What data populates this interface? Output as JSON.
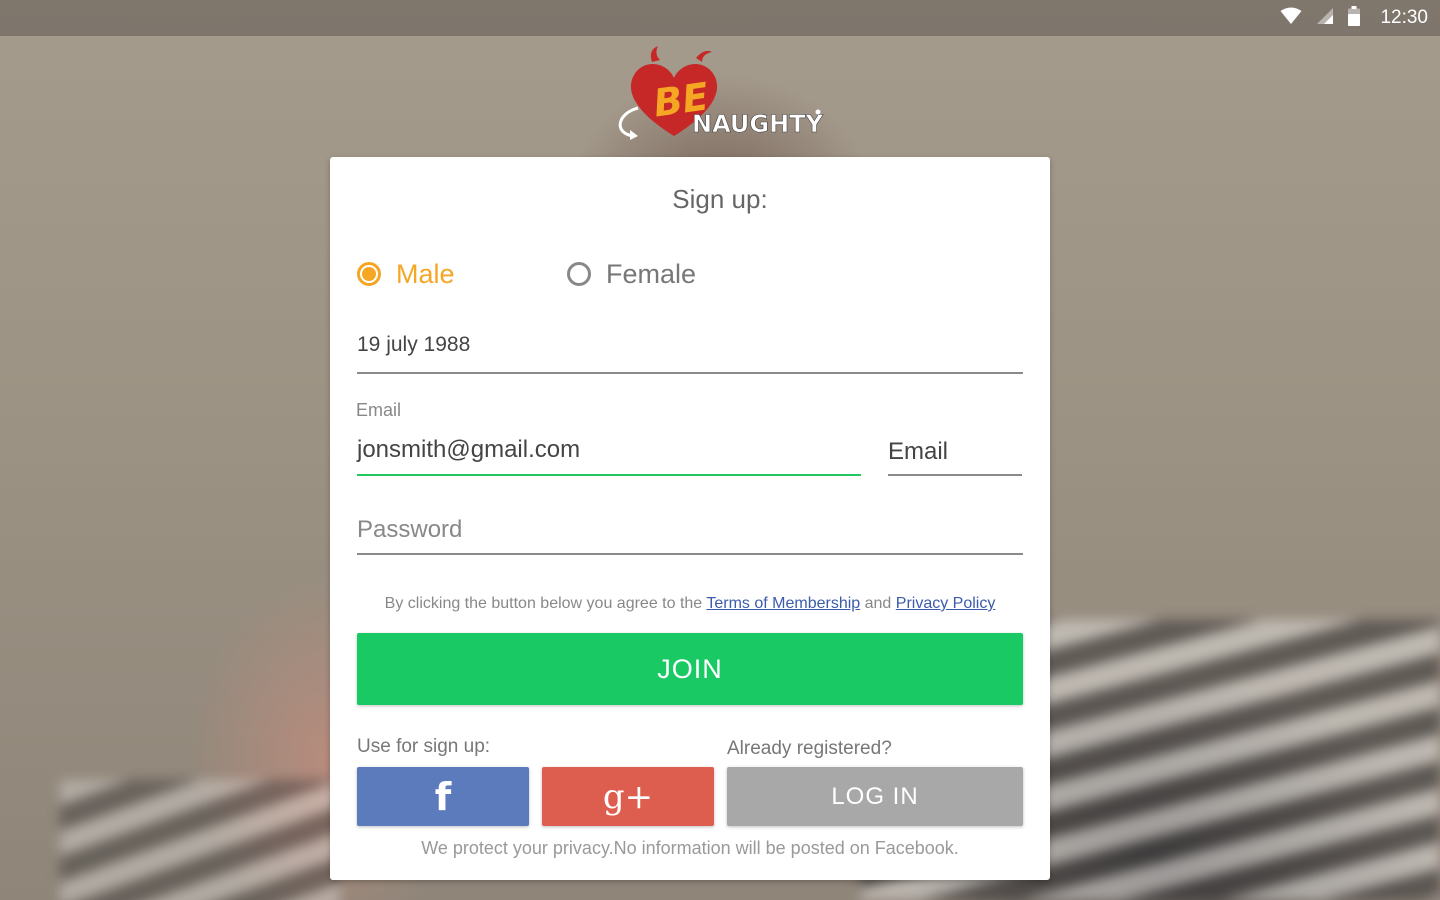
{
  "status_bar": {
    "time": "12:30",
    "icons": [
      "wifi-icon",
      "signal-icon",
      "battery-icon"
    ]
  },
  "logo": {
    "text_be": "BE",
    "text_naughty": "NAUGHTY"
  },
  "signup": {
    "title": "Sign up:",
    "gender": {
      "options": [
        "Male",
        "Female"
      ],
      "selected": "Male"
    },
    "birthdate_value": "19 july 1988",
    "email_label": "Email",
    "email_value": "jonsmith@gmail.com",
    "email_type_value": "Email",
    "password_placeholder": "Password",
    "terms": {
      "prefix": "By clicking the button below you agree to the ",
      "terms_link": "Terms of Membership",
      "and": " and ",
      "privacy_link": "Privacy Policy"
    },
    "join_label": "JOIN",
    "use_for_signup_label": "Use for sign up:",
    "already_registered_label": "Already registered?",
    "login_label": "LOG IN",
    "facebook_glyph": "f",
    "google_glyph": "g+",
    "privacy_note": "We protect your privacy.No information will be posted on Facebook."
  },
  "colors": {
    "accent_orange": "#f5a623",
    "join_green": "#18c964",
    "facebook_blue": "#5b7bbd",
    "google_red": "#dd5e4e",
    "login_gray": "#a8a8a8",
    "field_focus_green": "#22c55e",
    "link_blue": "#3b5bab",
    "logo_red": "#c62828"
  }
}
